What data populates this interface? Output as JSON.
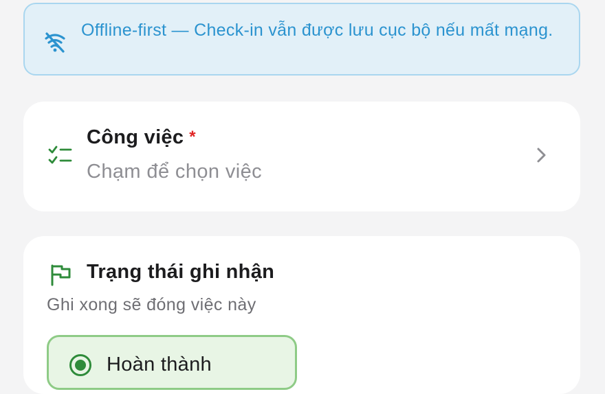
{
  "banner": {
    "text": "Offline-first — Check-in vẫn được lưu cục bộ nếu mất mạng.",
    "icon": "wifi-off-icon",
    "color": "#2b93cf",
    "background": "#e2f0f8"
  },
  "task_field": {
    "label": "Công việc",
    "required_mark": "*",
    "placeholder": "Chạm để chọn việc",
    "icon": "checklist-icon",
    "trailing_icon": "chevron-right-icon"
  },
  "status_section": {
    "title": "Trạng thái ghi nhận",
    "subtitle": "Ghi xong sẽ đóng việc này",
    "icon": "flag-icon",
    "options": [
      {
        "label": "Hoàn thành",
        "selected": true
      }
    ],
    "accent": "#2e8b3a"
  }
}
